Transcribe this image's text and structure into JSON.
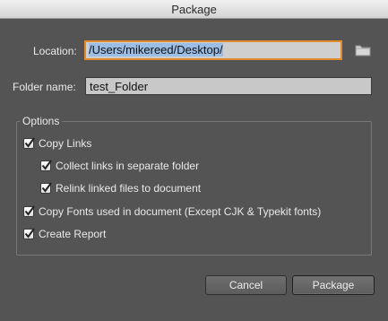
{
  "window": {
    "title": "Package"
  },
  "location": {
    "label": "Location:",
    "value": "/Users/mikereed/Desktop/",
    "browse_icon": "folder-icon"
  },
  "folder_name": {
    "label": "Folder name:",
    "value": "test_Folder"
  },
  "options": {
    "group_label": "Options",
    "items": [
      {
        "label": "Copy Links",
        "checked": true
      },
      {
        "label": "Collect links in separate folder",
        "checked": true
      },
      {
        "label": "Relink linked files to document",
        "checked": true
      },
      {
        "label": "Copy Fonts used in document (Except CJK & Typekit fonts)",
        "checked": true
      },
      {
        "label": "Create Report",
        "checked": true
      }
    ]
  },
  "buttons": {
    "cancel": "Cancel",
    "package": "Package"
  },
  "colors": {
    "background": "#545454",
    "focus_ring": "#e08a2c",
    "selection": "#9bbde6"
  }
}
